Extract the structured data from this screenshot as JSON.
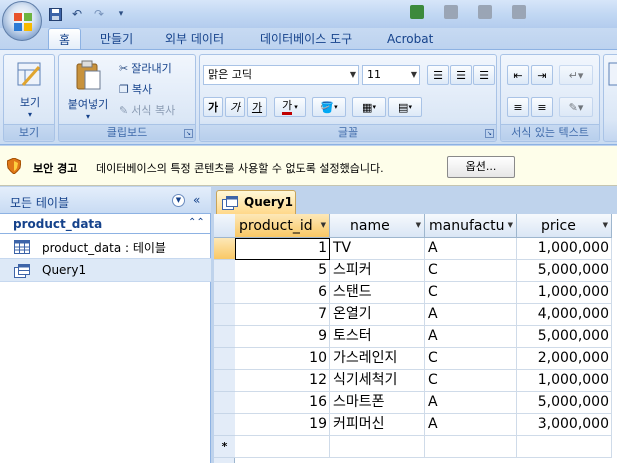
{
  "titlebar": {
    "office_button": "office-logo",
    "qat_icons": [
      "save-icon",
      "undo-icon",
      "redo-icon",
      "customize-icon"
    ]
  },
  "tabs": [
    "홈",
    "만들기",
    "외부 데이터",
    "데이터베이스 도구",
    "Acrobat"
  ],
  "ribbon": {
    "views": {
      "button": "보기",
      "group": "보기"
    },
    "clipboard": {
      "paste": "붙여넣기",
      "cut": "잘라내기",
      "copy": "복사",
      "format_painter": "서식 복사",
      "group": "클립보드"
    },
    "font": {
      "name": "맑은 고딕",
      "size": "11",
      "bold": "가",
      "italic": "가",
      "underline": "가",
      "font_color": "가",
      "group": "글꼴"
    },
    "rich_text": {
      "group": "서식 있는 텍스트"
    },
    "accent_color": "#c00000"
  },
  "security_bar": {
    "title": "보안 경고",
    "message": "데이터베이스의 특정 콘텐츠를 사용할 수 없도록 설정했습니다.",
    "options_button": "옵션..."
  },
  "nav": {
    "header": "모든 테이블",
    "group": "product_data",
    "items": [
      {
        "label": "product_data : 테이블",
        "icon": "table-icon",
        "selected": false
      },
      {
        "label": "Query1",
        "icon": "query-icon",
        "selected": true
      }
    ]
  },
  "document": {
    "tab": "Query1",
    "columns": [
      "product_id",
      "name",
      "manufactu",
      "price"
    ],
    "rows": [
      {
        "product_id": "1",
        "name": "TV",
        "manufacturer": "A",
        "price": "1,000,000"
      },
      {
        "product_id": "5",
        "name": "스피커",
        "manufacturer": "C",
        "price": "5,000,000"
      },
      {
        "product_id": "6",
        "name": "스탠드",
        "manufacturer": "C",
        "price": "1,000,000"
      },
      {
        "product_id": "7",
        "name": "온열기",
        "manufacturer": "A",
        "price": "4,000,000"
      },
      {
        "product_id": "9",
        "name": "토스터",
        "manufacturer": "A",
        "price": "5,000,000"
      },
      {
        "product_id": "10",
        "name": "가스레인지",
        "manufacturer": "C",
        "price": "2,000,000"
      },
      {
        "product_id": "12",
        "name": "식기세척기",
        "manufacturer": "C",
        "price": "1,000,000"
      },
      {
        "product_id": "16",
        "name": "스마트폰",
        "manufacturer": "A",
        "price": "5,000,000"
      },
      {
        "product_id": "19",
        "name": "커피머신",
        "manufacturer": "A",
        "price": "3,000,000"
      }
    ],
    "new_row_marker": "*"
  }
}
